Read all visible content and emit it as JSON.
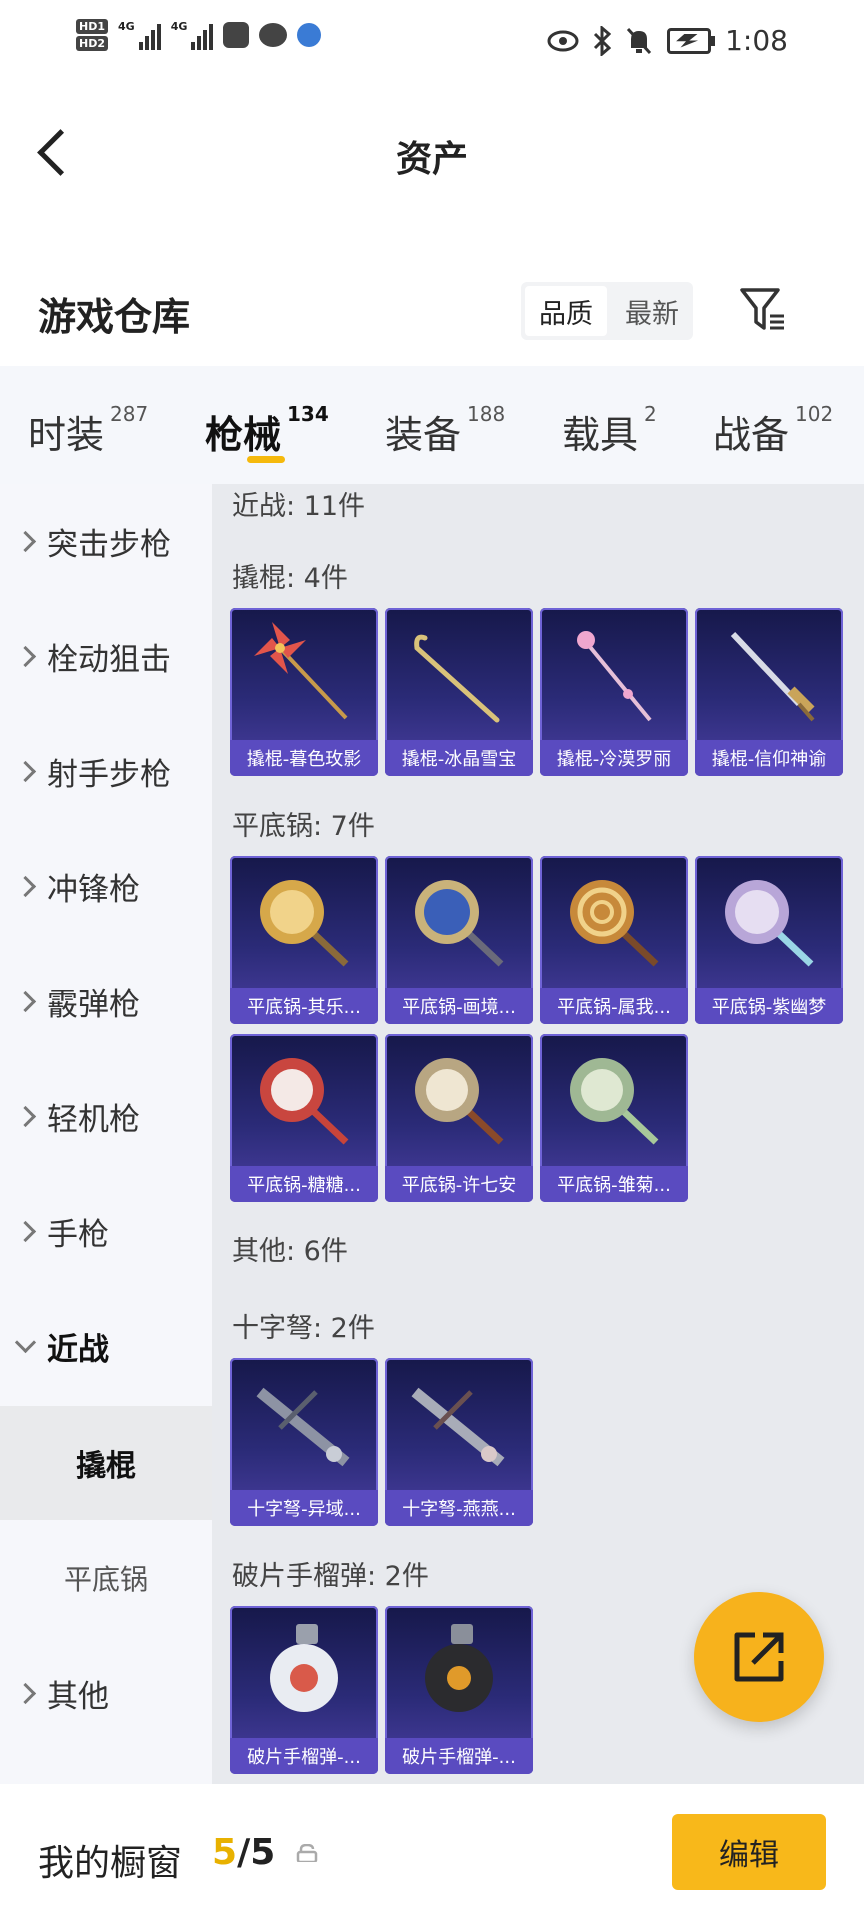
{
  "status_bar": {
    "network": "4G",
    "time": "1:08",
    "icons": [
      "hd-icon",
      "signal-icon",
      "app-icon",
      "chat-icon",
      "browser-icon",
      "eye-icon",
      "bluetooth-icon",
      "mute-icon",
      "battery-icon"
    ]
  },
  "header": {
    "title": "资产"
  },
  "warehouse": {
    "title": "游戏仓库",
    "sort_options": [
      "品质",
      "最新"
    ],
    "sort_selected": "品质"
  },
  "tabs": [
    {
      "label": "时装",
      "count": "287"
    },
    {
      "label": "枪械",
      "count": "134",
      "active": true
    },
    {
      "label": "装备",
      "count": "188"
    },
    {
      "label": "载具",
      "count": "2"
    },
    {
      "label": "战备",
      "count": "102"
    }
  ],
  "sidebar": {
    "items": [
      "突击步枪",
      "栓动狙击",
      "射手步枪",
      "冲锋枪",
      "霰弹枪",
      "轻机枪",
      "手枪",
      "近战",
      "其他"
    ],
    "sub_items": [
      "撬棍",
      "平底锅"
    ],
    "open_item": "近战",
    "selected_sub": "撬棍"
  },
  "content": {
    "melee_header": "近战: 11件",
    "crowbar_label": "撬棍: 4件",
    "crowbar_items": [
      "撬棍-暮色玫影",
      "撬棍-冰晶雪宝",
      "撬棍-冷漠罗丽",
      "撬棍-信仰神谕"
    ],
    "pan_label": "平底锅: 7件",
    "pan_items": [
      "平底锅-其乐...",
      "平底锅-画境...",
      "平底锅-属我...",
      "平底锅-紫幽梦",
      "平底锅-糖糖...",
      "平底锅-许七安",
      "平底锅-雏菊..."
    ],
    "other_header": "其他: 6件",
    "crossbow_label": "十字弩: 2件",
    "crossbow_items": [
      "十字弩-异域...",
      "十字弩-燕燕..."
    ],
    "grenade_label": "破片手榴弹: 2件",
    "grenade_items": [
      "破片手榴弹-...",
      "破片手榴弹-..."
    ]
  },
  "bottom": {
    "title": "我的橱窗",
    "count_used": "5",
    "count_sep": "/",
    "count_total": "5",
    "edit_label": "编辑"
  },
  "colors": {
    "accent": "#f8b81a",
    "card_caption": "#5a4bc0",
    "card_bg": "#2b2b78"
  }
}
